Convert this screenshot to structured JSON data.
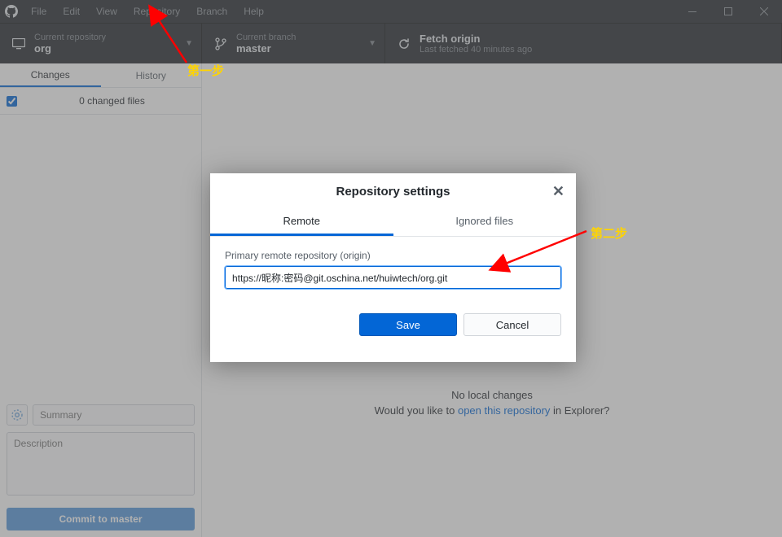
{
  "menubar": {
    "items": [
      "File",
      "Edit",
      "View",
      "Repository",
      "Branch",
      "Help"
    ]
  },
  "toolbar": {
    "repo": {
      "label": "Current repository",
      "value": "org"
    },
    "branch": {
      "label": "Current branch",
      "value": "master"
    },
    "fetch": {
      "label": "Fetch origin",
      "sub": "Last fetched 40 minutes ago"
    }
  },
  "sidebar": {
    "tabs": {
      "changes": "Changes",
      "history": "History"
    },
    "changed_files": "0 changed files",
    "summary_placeholder": "Summary",
    "description_placeholder": "Description",
    "commit_button_prefix": "Commit to ",
    "commit_button_branch": "master"
  },
  "main": {
    "no_local_changes": "No local changes",
    "prompt_pre": "Would you like to ",
    "prompt_link": "open this repository",
    "prompt_post": " in Explorer?"
  },
  "modal": {
    "title": "Repository settings",
    "tabs": {
      "remote": "Remote",
      "ignored": "Ignored files"
    },
    "field_label": "Primary remote repository (origin)",
    "field_value": "https://昵称:密码@git.oschina.net/huiwtech/org.git",
    "save": "Save",
    "cancel": "Cancel"
  },
  "annotations": {
    "step1": "第一步",
    "step2": "第二步"
  }
}
